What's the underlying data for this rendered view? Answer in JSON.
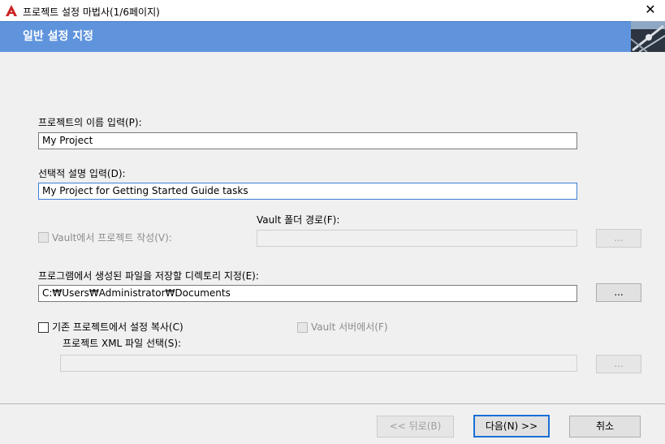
{
  "window": {
    "title": "프로젝트 설정 마법사(1/6페이지)",
    "close_glyph": "✕"
  },
  "header": {
    "title": "일반 설정 지정"
  },
  "form": {
    "project_name_label": "프로젝트의 이름 입력(P):",
    "project_name_value": "My Project",
    "description_label": "선택적 설명 입력(D):",
    "description_value": "My Project for Getting Started Guide tasks",
    "vault_folder_label": "Vault 폴더 경로(F):",
    "vault_create_label": "Vault에서 프로젝트 작성(V):",
    "vault_folder_value": "",
    "browse_label": "...",
    "directory_label": "프로그램에서 생성된 파일을 저장할 디렉토리 지정(E):",
    "directory_value": "C:₩Users₩Administrator₩Documents",
    "copy_settings_label": "기존 프로젝트에서 설정 복사(C)",
    "from_vault_server_label": "Vault 서버에서(F)",
    "xml_file_label": "프로젝트 XML 파일 선택(S):",
    "xml_file_value": ""
  },
  "footer": {
    "back_label": "<< 뒤로(B)",
    "next_label": "다음(N) >>",
    "cancel_label": "취소"
  },
  "colors": {
    "header_bg": "#5f94dd",
    "app_icon": "#cc2222",
    "focus_border": "#3c7fd6"
  }
}
